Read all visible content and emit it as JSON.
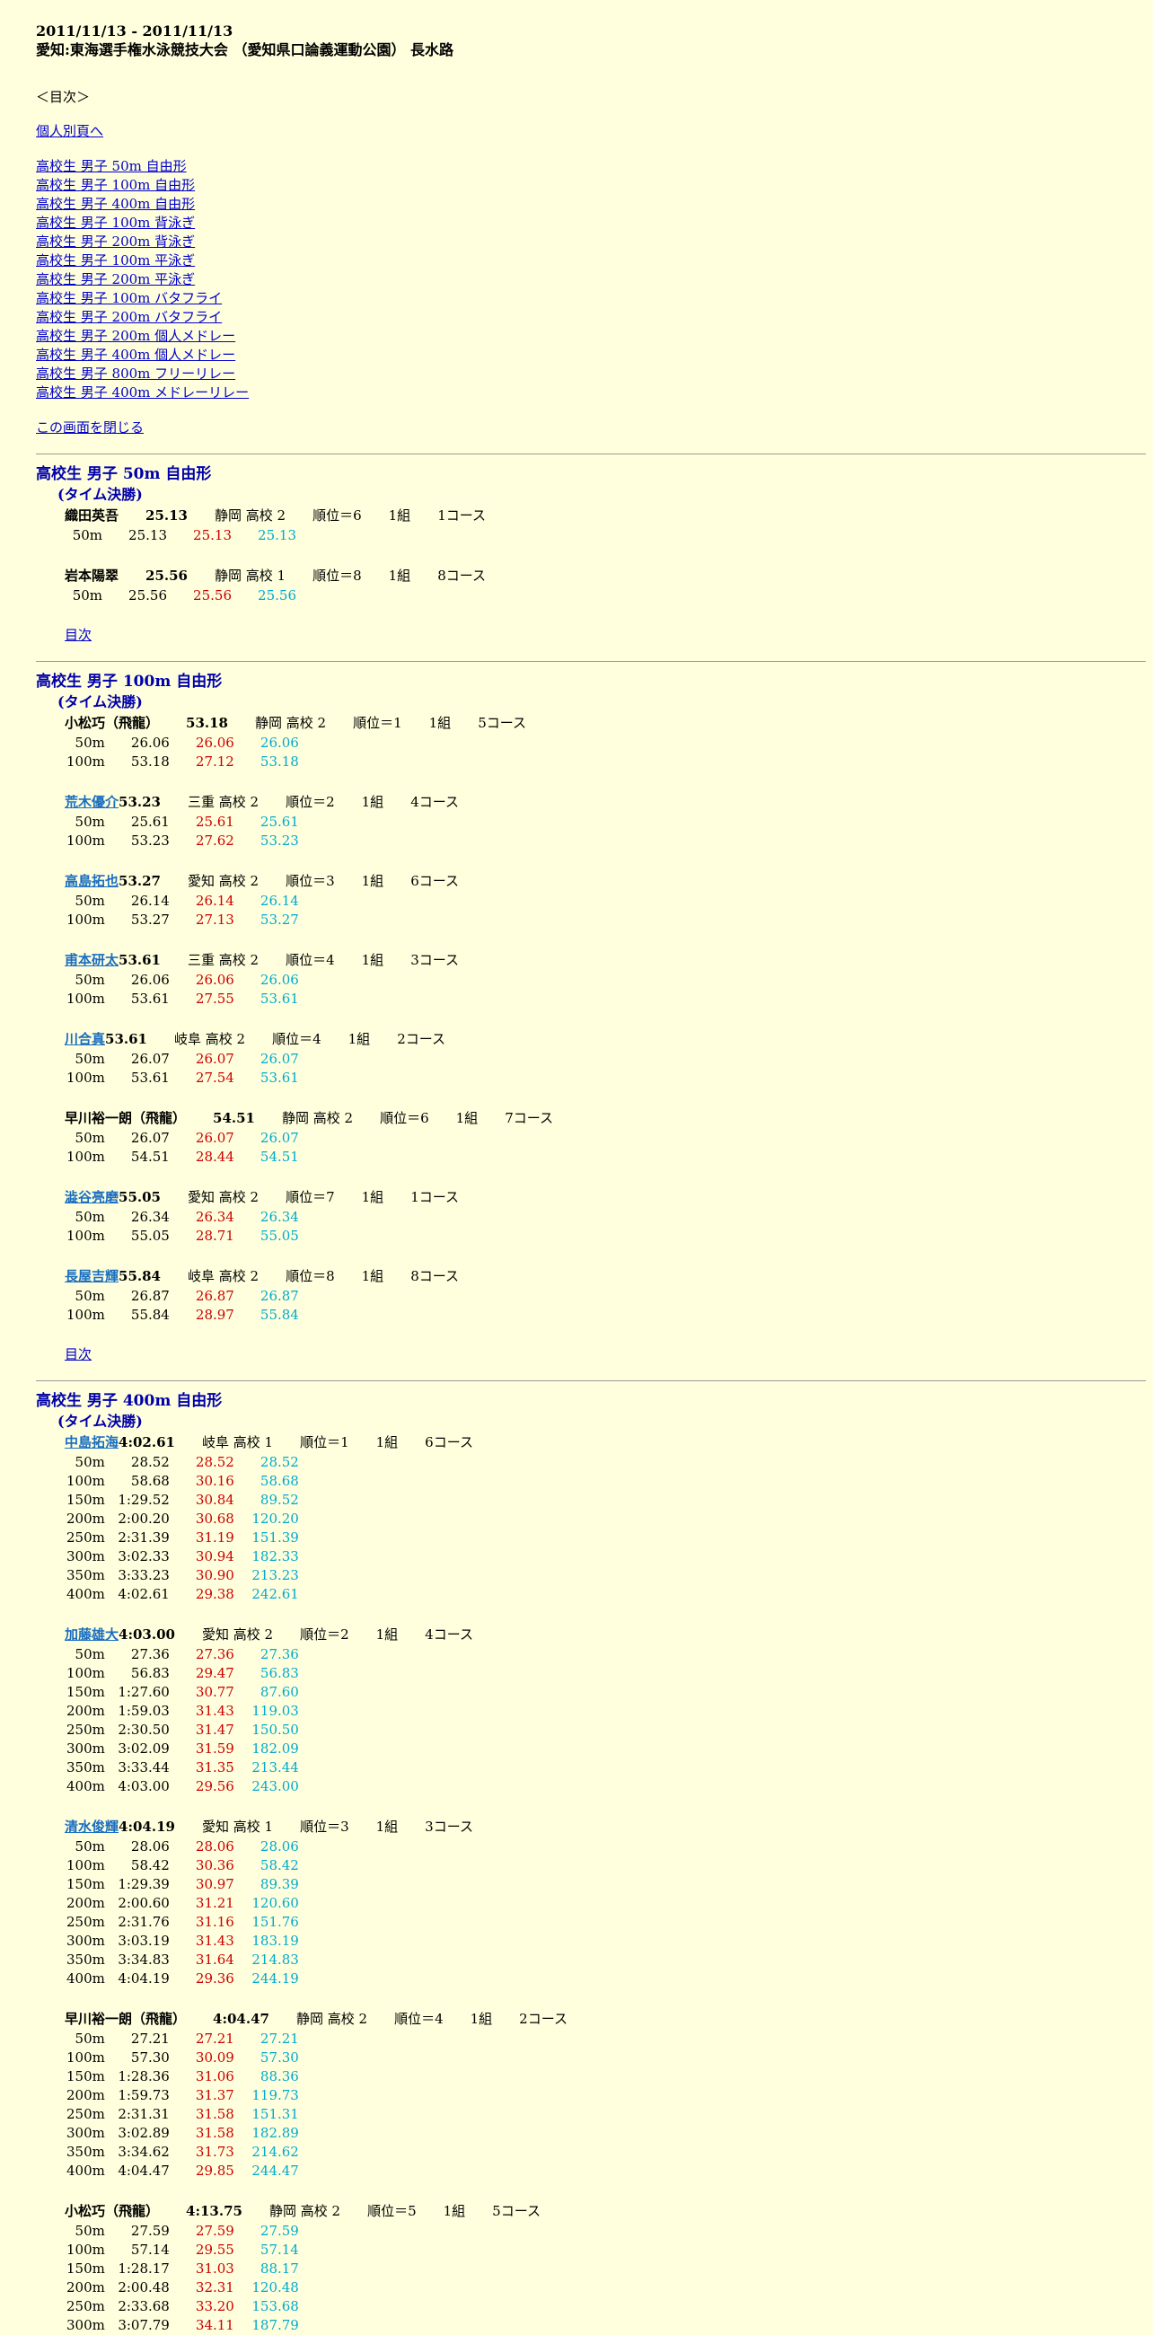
{
  "header": {
    "date_range": "2011/11/13 - 2011/11/13",
    "meet": "愛知:東海選手権水泳競技大会 （愛知県口論義運動公園） 長水路"
  },
  "toc": {
    "title": "＜目次＞",
    "individual_link": "個人別頁へ",
    "events": [
      "高校生 男子 50m 自由形",
      "高校生 男子 100m 自由形",
      "高校生 男子 400m 自由形",
      "高校生 男子 100m 背泳ぎ",
      "高校生 男子 200m 背泳ぎ",
      "高校生 男子 100m 平泳ぎ",
      "高校生 男子 200m 平泳ぎ",
      "高校生 男子 100m バタフライ",
      "高校生 男子 200m バタフライ",
      "高校生 男子 200m 個人メドレー",
      "高校生 男子 400m 個人メドレー",
      "高校生 男子 800m フリーリレー",
      "高校生 男子 400m メドレーリレー"
    ],
    "close_link": "この画面を閉じる"
  },
  "back_label": "目次",
  "events": [
    {
      "title": "高校生 男子 50m 自由形",
      "subtitle": "(タイム決勝)",
      "swimmers": [
        {
          "name": "織田英吾",
          "link": false,
          "time": "25.13",
          "team": "静岡 高校 2",
          "rank": "順位＝6",
          "heat": "1組",
          "lane": "1コース",
          "splits": [
            [
              "50m",
              "25.13",
              "25.13",
              "25.13"
            ]
          ]
        },
        {
          "name": "岩本陽翠",
          "link": false,
          "time": "25.56",
          "team": "静岡 高校 1",
          "rank": "順位＝8",
          "heat": "1組",
          "lane": "8コース",
          "splits": [
            [
              "50m",
              "25.56",
              "25.56",
              "25.56"
            ]
          ]
        }
      ]
    },
    {
      "title": "高校生 男子 100m 自由形",
      "subtitle": "(タイム決勝)",
      "swimmers": [
        {
          "name": "小松巧（飛龍）",
          "link": false,
          "time": "53.18",
          "team": "静岡 高校 2",
          "rank": "順位＝1",
          "heat": "1組",
          "lane": "5コース",
          "splits": [
            [
              "50m",
              "26.06",
              "26.06",
              "26.06"
            ],
            [
              "100m",
              "53.18",
              "27.12",
              "53.18"
            ]
          ]
        },
        {
          "name": "荒木優介",
          "link": true,
          "time": "53.23",
          "team": "三重 高校 2",
          "rank": "順位＝2",
          "heat": "1組",
          "lane": "4コース",
          "splits": [
            [
              "50m",
              "25.61",
              "25.61",
              "25.61"
            ],
            [
              "100m",
              "53.23",
              "27.62",
              "53.23"
            ]
          ]
        },
        {
          "name": "高島拓也",
          "link": true,
          "time": "53.27",
          "team": "愛知 高校 2",
          "rank": "順位＝3",
          "heat": "1組",
          "lane": "6コース",
          "splits": [
            [
              "50m",
              "26.14",
              "26.14",
              "26.14"
            ],
            [
              "100m",
              "53.27",
              "27.13",
              "53.27"
            ]
          ]
        },
        {
          "name": "甫本研太",
          "link": true,
          "time": "53.61",
          "team": "三重 高校 2",
          "rank": "順位＝4",
          "heat": "1組",
          "lane": "3コース",
          "splits": [
            [
              "50m",
              "26.06",
              "26.06",
              "26.06"
            ],
            [
              "100m",
              "53.61",
              "27.55",
              "53.61"
            ]
          ]
        },
        {
          "name": "川合真",
          "link": true,
          "time": "53.61",
          "team": "岐阜 高校 2",
          "rank": "順位＝4",
          "heat": "1組",
          "lane": "2コース",
          "splits": [
            [
              "50m",
              "26.07",
              "26.07",
              "26.07"
            ],
            [
              "100m",
              "53.61",
              "27.54",
              "53.61"
            ]
          ]
        },
        {
          "name": "早川裕一朗（飛龍）",
          "link": false,
          "time": "54.51",
          "team": "静岡 高校 2",
          "rank": "順位＝6",
          "heat": "1組",
          "lane": "7コース",
          "splits": [
            [
              "50m",
              "26.07",
              "26.07",
              "26.07"
            ],
            [
              "100m",
              "54.51",
              "28.44",
              "54.51"
            ]
          ]
        },
        {
          "name": "澁谷亮磨",
          "link": true,
          "time": "55.05",
          "team": "愛知 高校 2",
          "rank": "順位＝7",
          "heat": "1組",
          "lane": "1コース",
          "splits": [
            [
              "50m",
              "26.34",
              "26.34",
              "26.34"
            ],
            [
              "100m",
              "55.05",
              "28.71",
              "55.05"
            ]
          ]
        },
        {
          "name": "長屋吉輝",
          "link": true,
          "time": "55.84",
          "team": "岐阜 高校 2",
          "rank": "順位＝8",
          "heat": "1組",
          "lane": "8コース",
          "splits": [
            [
              "50m",
              "26.87",
              "26.87",
              "26.87"
            ],
            [
              "100m",
              "55.84",
              "28.97",
              "55.84"
            ]
          ]
        }
      ]
    },
    {
      "title": "高校生 男子 400m 自由形",
      "subtitle": "(タイム決勝)",
      "swimmers": [
        {
          "name": "中島拓海",
          "link": true,
          "time": "4:02.61",
          "team": "岐阜 高校 1",
          "rank": "順位＝1",
          "heat": "1組",
          "lane": "6コース",
          "splits": [
            [
              "50m",
              "28.52",
              "28.52",
              "28.52"
            ],
            [
              "100m",
              "58.68",
              "30.16",
              "58.68"
            ],
            [
              "150m",
              "1:29.52",
              "30.84",
              "89.52"
            ],
            [
              "200m",
              "2:00.20",
              "30.68",
              "120.20"
            ],
            [
              "250m",
              "2:31.39",
              "31.19",
              "151.39"
            ],
            [
              "300m",
              "3:02.33",
              "30.94",
              "182.33"
            ],
            [
              "350m",
              "3:33.23",
              "30.90",
              "213.23"
            ],
            [
              "400m",
              "4:02.61",
              "29.38",
              "242.61"
            ]
          ]
        },
        {
          "name": "加藤雄大",
          "link": true,
          "time": "4:03.00",
          "team": "愛知 高校 2",
          "rank": "順位＝2",
          "heat": "1組",
          "lane": "4コース",
          "splits": [
            [
              "50m",
              "27.36",
              "27.36",
              "27.36"
            ],
            [
              "100m",
              "56.83",
              "29.47",
              "56.83"
            ],
            [
              "150m",
              "1:27.60",
              "30.77",
              "87.60"
            ],
            [
              "200m",
              "1:59.03",
              "31.43",
              "119.03"
            ],
            [
              "250m",
              "2:30.50",
              "31.47",
              "150.50"
            ],
            [
              "300m",
              "3:02.09",
              "31.59",
              "182.09"
            ],
            [
              "350m",
              "3:33.44",
              "31.35",
              "213.44"
            ],
            [
              "400m",
              "4:03.00",
              "29.56",
              "243.00"
            ]
          ]
        },
        {
          "name": "清水俊輝",
          "link": true,
          "time": "4:04.19",
          "team": "愛知 高校 1",
          "rank": "順位＝3",
          "heat": "1組",
          "lane": "3コース",
          "splits": [
            [
              "50m",
              "28.06",
              "28.06",
              "28.06"
            ],
            [
              "100m",
              "58.42",
              "30.36",
              "58.42"
            ],
            [
              "150m",
              "1:29.39",
              "30.97",
              "89.39"
            ],
            [
              "200m",
              "2:00.60",
              "31.21",
              "120.60"
            ],
            [
              "250m",
              "2:31.76",
              "31.16",
              "151.76"
            ],
            [
              "300m",
              "3:03.19",
              "31.43",
              "183.19"
            ],
            [
              "350m",
              "3:34.83",
              "31.64",
              "214.83"
            ],
            [
              "400m",
              "4:04.19",
              "29.36",
              "244.19"
            ]
          ]
        },
        {
          "name": "早川裕一朗（飛龍）",
          "link": false,
          "time": "4:04.47",
          "team": "静岡 高校 2",
          "rank": "順位＝4",
          "heat": "1組",
          "lane": "2コース",
          "splits": [
            [
              "50m",
              "27.21",
              "27.21",
              "27.21"
            ],
            [
              "100m",
              "57.30",
              "30.09",
              "57.30"
            ],
            [
              "150m",
              "1:28.36",
              "31.06",
              "88.36"
            ],
            [
              "200m",
              "1:59.73",
              "31.37",
              "119.73"
            ],
            [
              "250m",
              "2:31.31",
              "31.58",
              "151.31"
            ],
            [
              "300m",
              "3:02.89",
              "31.58",
              "182.89"
            ],
            [
              "350m",
              "3:34.62",
              "31.73",
              "214.62"
            ],
            [
              "400m",
              "4:04.47",
              "29.85",
              "244.47"
            ]
          ]
        },
        {
          "name": "小松巧（飛龍）",
          "link": false,
          "time": "4:13.75",
          "team": "静岡 高校 2",
          "rank": "順位＝5",
          "heat": "1組",
          "lane": "5コース",
          "splits": [
            [
              "50m",
              "27.59",
              "27.59",
              "27.59"
            ],
            [
              "100m",
              "57.14",
              "29.55",
              "57.14"
            ],
            [
              "150m",
              "1:28.17",
              "31.03",
              "88.17"
            ],
            [
              "200m",
              "2:00.48",
              "32.31",
              "120.48"
            ],
            [
              "250m",
              "2:33.68",
              "33.20",
              "153.68"
            ],
            [
              "300m",
              "3:07.79",
              "34.11",
              "187.79"
            ]
          ]
        }
      ]
    }
  ]
}
